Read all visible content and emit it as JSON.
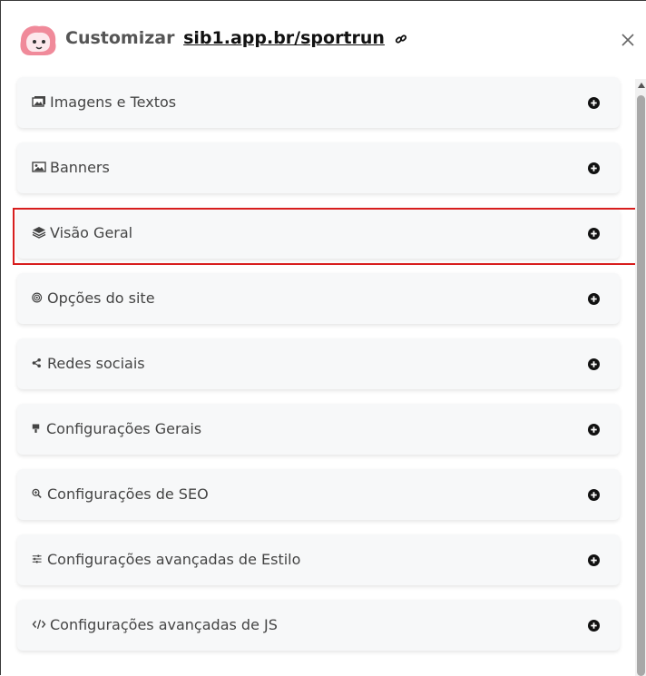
{
  "header": {
    "title_prefix": "Customizar",
    "site_link": "sib1.app.br/sportrun",
    "close_icon": "close-icon",
    "chain_icon": "link-icon"
  },
  "accent_colors": {
    "highlight_border": "#d81e1e",
    "logo_pink": "#f08a9a"
  },
  "sections": [
    {
      "label": "Imagens e Textos",
      "icon": "images-icon"
    },
    {
      "label": "Banners",
      "icon": "image-icon"
    },
    {
      "label": "Visão Geral",
      "icon": "layers-icon"
    },
    {
      "label": "Opções do site",
      "icon": "bullseye-icon"
    },
    {
      "label": "Redes sociais",
      "icon": "share-icon"
    },
    {
      "label": "Configurações Gerais",
      "icon": "paint-brush-icon"
    },
    {
      "label": "Configurações de SEO",
      "icon": "search-plus-icon"
    },
    {
      "label": "Configurações avançadas de Estilo",
      "icon": "sliders-icon"
    },
    {
      "label": "Configurações avançadas de JS",
      "icon": "code-icon"
    }
  ],
  "expand_icon": "plus-circle-icon",
  "highlighted_section": "Visão Geral"
}
